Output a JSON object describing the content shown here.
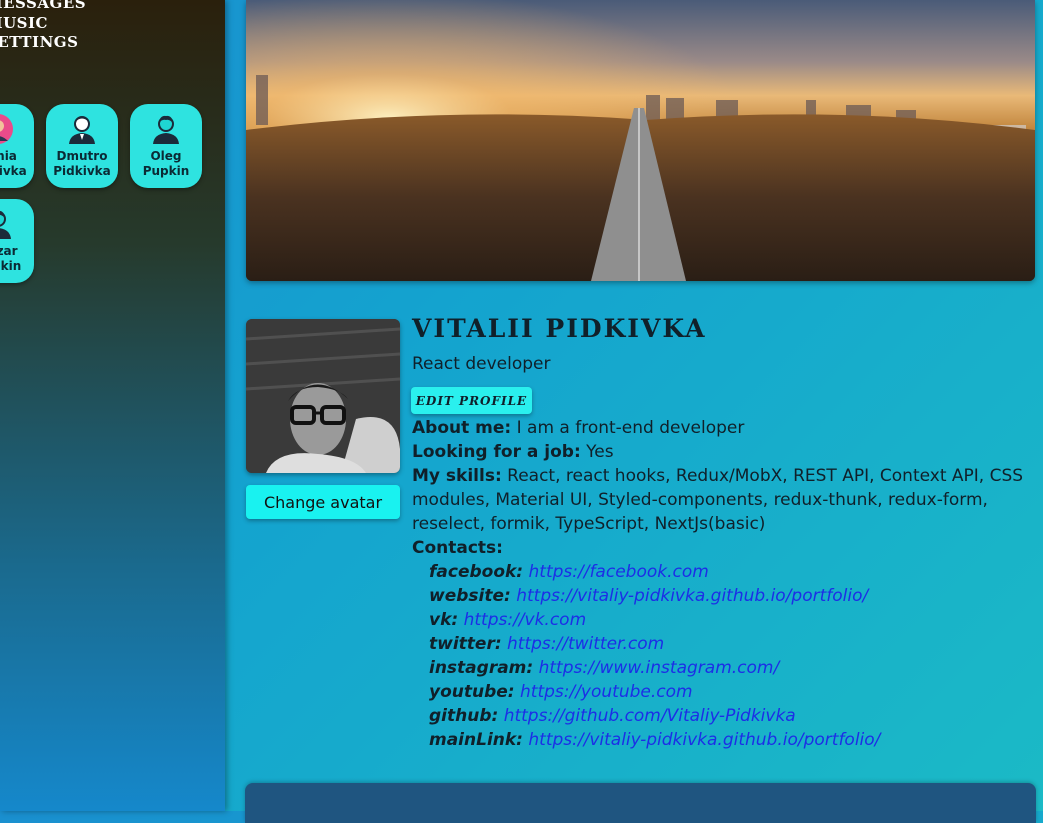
{
  "sidebar": {
    "nav": [
      "Messages",
      "Music",
      "Settings"
    ],
    "friends": [
      {
        "name_line1": "Xenia",
        "name_line2": "Pidkivka",
        "icon": "avatar-female-icon"
      },
      {
        "name_line1": "Dmutro",
        "name_line2": "Pidkivka",
        "icon": "avatar-businessman-icon"
      },
      {
        "name_line1": "Oleg",
        "name_line2": "Pupkin",
        "icon": "avatar-man-icon"
      },
      {
        "name_line1": "Nazar",
        "name_line2": "Pupkin",
        "icon": "avatar-man-icon"
      }
    ]
  },
  "profile": {
    "name": "Vitalii Pidkivka",
    "status": "React developer",
    "edit_label": "Edit profile",
    "change_avatar_label": "Change avatar",
    "about_label": "About me:",
    "about_value": "I am a front-end developer",
    "job_label": "Looking for a job:",
    "job_value": "Yes",
    "skills_label": "My skills:",
    "skills_value": "React, react hooks, Redux/MobX, REST API, Context API, CSS modules, Material UI, Styled-components, redux-thunk, redux-form, reselect, formik, TypeScript, NextJs(basic)",
    "contacts_label": "Contacts:",
    "contacts": [
      {
        "key": "facebook:",
        "url": "https://facebook.com"
      },
      {
        "key": "website:",
        "url": "https://vitaliy-pidkivka.github.io/portfolio/"
      },
      {
        "key": "vk:",
        "url": "https://vk.com"
      },
      {
        "key": "twitter:",
        "url": "https://twitter.com"
      },
      {
        "key": "instagram:",
        "url": "https://www.instagram.com/"
      },
      {
        "key": "youtube:",
        "url": "https://youtube.com"
      },
      {
        "key": "github:",
        "url": "https://github.com/Vitaliy-Pidkivka"
      },
      {
        "key": "mainLink:",
        "url": "https://vitaliy-pidkivka.github.io/portfolio/"
      }
    ]
  },
  "colors": {
    "accent": "#19f2f0",
    "link": "#1c2ee6"
  }
}
